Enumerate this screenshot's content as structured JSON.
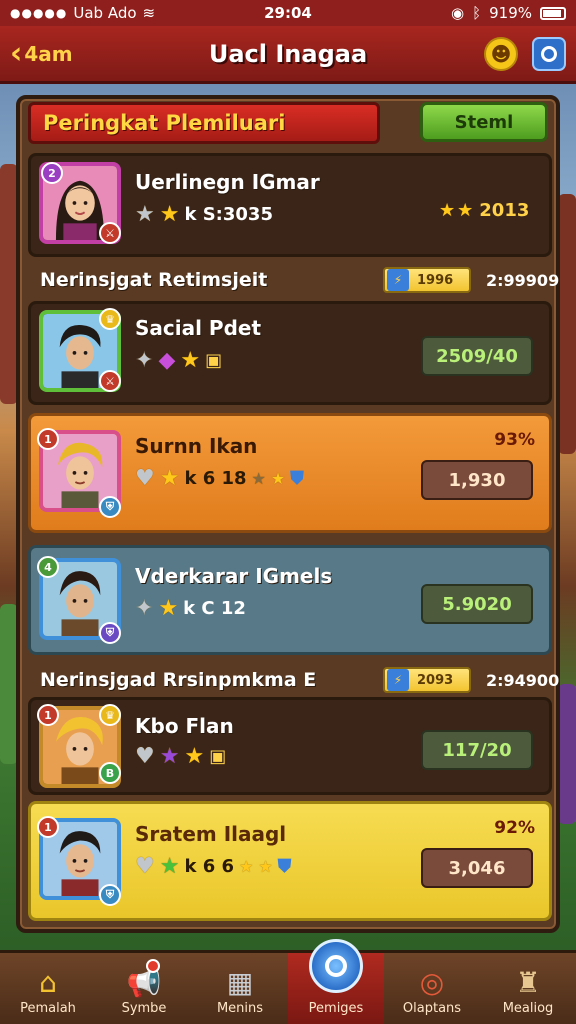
{
  "status_bar": {
    "carrier": "Uab Ado",
    "time": "29:04",
    "battery": "919%"
  },
  "header": {
    "back_label": "4am",
    "title": "Uacl Inagaa"
  },
  "panel": {
    "title": "Peringkat Plemiluari",
    "start_button": "Steml"
  },
  "featured": {
    "name": "Uerlinegn IGmar",
    "stat": "k S:3035",
    "right_stat": "2013"
  },
  "sections": [
    {
      "label": "Nerinsjgat Retimsjeit",
      "chip": "1996",
      "value": "2:99909"
    },
    {
      "label": "Nerinsjgad Rrsinpmkma E",
      "chip": "2093",
      "value": "2:94900"
    }
  ],
  "players": [
    {
      "name": "Sacial Pdet",
      "stat": "",
      "score": "2509/40",
      "pct": ""
    },
    {
      "name": "Surnn Ikan",
      "stat": "k 6 18",
      "score": "1,930",
      "pct": "93%"
    },
    {
      "name": "Vderkarar IGmels",
      "stat": "k C 12",
      "score": "5.9020",
      "pct": ""
    },
    {
      "name": "Kbo Flan",
      "stat": "",
      "score": "117/20",
      "pct": ""
    },
    {
      "name": "Sratem Ilaagl",
      "stat": "k 6 6",
      "score": "3,046",
      "pct": "92%"
    }
  ],
  "bottom_nav": [
    {
      "label": "Pemalah",
      "icon": "home-icon"
    },
    {
      "label": "Symbe",
      "icon": "megaphone-icon"
    },
    {
      "label": "Menins",
      "icon": "box-icon"
    },
    {
      "label": "Pemiges",
      "icon": "search-icon"
    },
    {
      "label": "Olaptans",
      "icon": "medal-icon"
    },
    {
      "label": "Mealiog",
      "icon": "chess-icon"
    }
  ],
  "colors": {
    "header": "#a8261f",
    "panel": "#5a3a22",
    "accent_green": "#8ed84a",
    "highlight_orange": "#f39a3a",
    "highlight_yellow": "#f7dc52"
  }
}
